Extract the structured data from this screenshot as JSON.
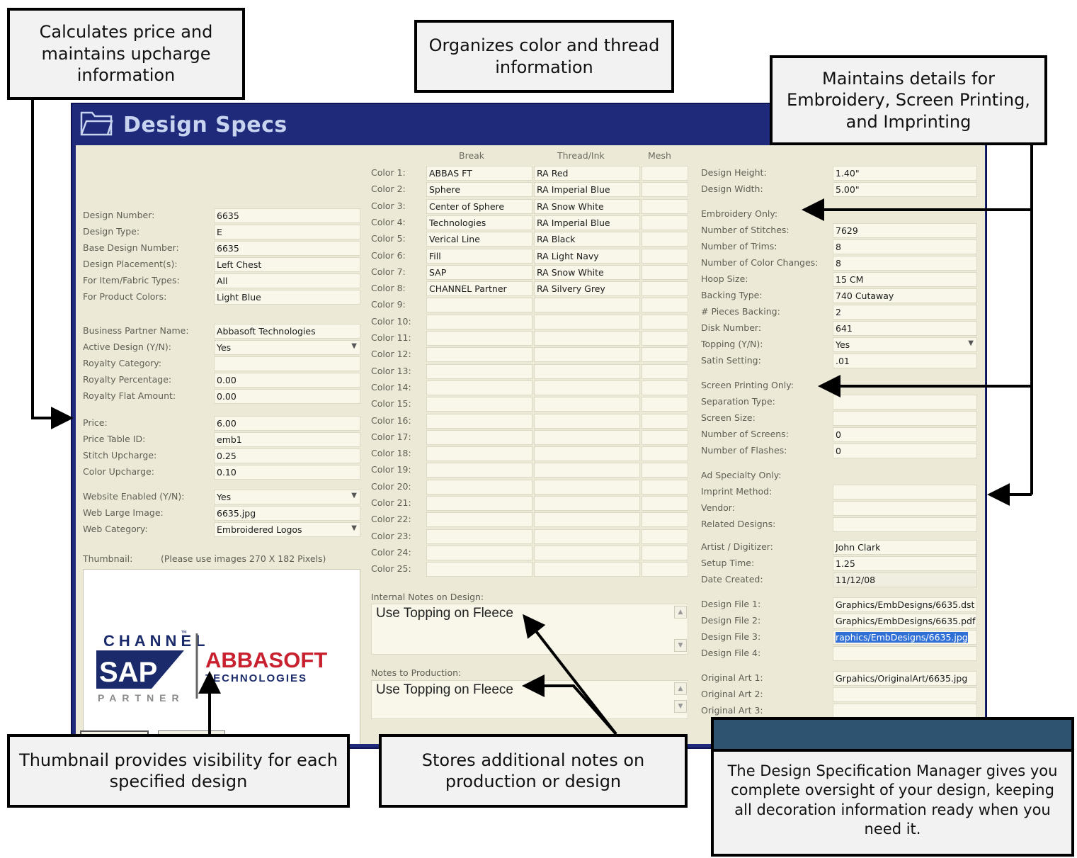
{
  "window": {
    "title": "Design Specs"
  },
  "left": {
    "fields": [
      {
        "label": "Design Number:",
        "value": "6635"
      },
      {
        "label": "Design Type:",
        "value": "E"
      },
      {
        "label": "Base Design Number:",
        "value": "6635"
      },
      {
        "label": "Design Placement(s):",
        "value": "Left Chest"
      },
      {
        "label": "For Item/Fabric Types:",
        "value": "All"
      },
      {
        "label": "For Product Colors:",
        "value": "Light Blue"
      },
      {
        "label": "Business Partner Name:",
        "value": "Abbasoft Technologies"
      },
      {
        "label": "Active Design (Y/N):",
        "value": "Yes"
      },
      {
        "label": "Royalty Category:",
        "value": ""
      },
      {
        "label": "Royalty Percentage:",
        "value": "0.00"
      },
      {
        "label": "Royalty Flat Amount:",
        "value": "0.00"
      },
      {
        "label": "Price:",
        "value": "6.00"
      },
      {
        "label": "Price Table ID:",
        "value": "emb1"
      },
      {
        "label": "Stitch Upcharge:",
        "value": "0.25"
      },
      {
        "label": "Color Upcharge:",
        "value": "0.10"
      },
      {
        "label": "Website Enabled (Y/N):",
        "value": "Yes"
      },
      {
        "label": "Web Large Image:",
        "value": "6635.jpg"
      },
      {
        "label": "Web Category:",
        "value": "Embroidered Logos"
      }
    ],
    "thumbnail_label": "Thumbnail:",
    "thumbnail_hint": "(Please use images  270 X 182  Pixels)",
    "logo": {
      "channel": "CHANNEL",
      "tm": "™",
      "sap": "SAP",
      "partner": "PARTNER",
      "abbasoft": "ABBASOFT",
      "technologies": "TECHNOLOGIES",
      "brand_blue": "#1b2a6b",
      "brand_red": "#c8202f"
    }
  },
  "colors": {
    "headers": {
      "break": "Break",
      "thread": "Thread/Ink",
      "mesh": "Mesh"
    },
    "rows": [
      {
        "label": "Color 1:",
        "break": "ABBAS FT",
        "thread": "RA Red"
      },
      {
        "label": "Color 2:",
        "break": "Sphere",
        "thread": "RA Imperial Blue"
      },
      {
        "label": "Color 3:",
        "break": "Center of Sphere",
        "thread": "RA Snow White"
      },
      {
        "label": "Color 4:",
        "break": "Technologies",
        "thread": "RA Imperial Blue"
      },
      {
        "label": "Color 5:",
        "break": "Verical Line",
        "thread": "RA Black"
      },
      {
        "label": "Color 6:",
        "break": "Fill",
        "thread": "RA Light Navy"
      },
      {
        "label": "Color 7:",
        "break": "SAP",
        "thread": "RA Snow White"
      },
      {
        "label": "Color 8:",
        "break": "CHANNEL Partner",
        "thread": "RA Silvery Grey"
      },
      {
        "label": "Color 9:",
        "break": "",
        "thread": ""
      },
      {
        "label": "Color 10:",
        "break": "",
        "thread": ""
      },
      {
        "label": "Color 11:",
        "break": "",
        "thread": ""
      },
      {
        "label": "Color 12:",
        "break": "",
        "thread": ""
      },
      {
        "label": "Color 13:",
        "break": "",
        "thread": ""
      },
      {
        "label": "Color 14:",
        "break": "",
        "thread": ""
      },
      {
        "label": "Color 15:",
        "break": "",
        "thread": ""
      },
      {
        "label": "Color 16:",
        "break": "",
        "thread": ""
      },
      {
        "label": "Color 17:",
        "break": "",
        "thread": ""
      },
      {
        "label": "Color 18:",
        "break": "",
        "thread": ""
      },
      {
        "label": "Color 19:",
        "break": "",
        "thread": ""
      },
      {
        "label": "Color 20:",
        "break": "",
        "thread": ""
      },
      {
        "label": "Color 21:",
        "break": "",
        "thread": ""
      },
      {
        "label": "Color 22:",
        "break": "",
        "thread": ""
      },
      {
        "label": "Color 23:",
        "break": "",
        "thread": ""
      },
      {
        "label": "Color 24:",
        "break": "",
        "thread": ""
      },
      {
        "label": "Color 25:",
        "break": "",
        "thread": ""
      }
    ],
    "internal_notes_label": "Internal Notes on Design:",
    "internal_notes": "Use Topping on Fleece",
    "production_notes_label": "Notes to Production:",
    "production_notes": "Use Topping on Fleece"
  },
  "right": {
    "fields": [
      {
        "label": "Design Height:",
        "value": "1.40\""
      },
      {
        "label": "Design Width:",
        "value": "5.00\""
      },
      {
        "label": "Embroidery Only:",
        "value": null
      },
      {
        "label": "Number of Stitches:",
        "value": "7629"
      },
      {
        "label": "Number of Trims:",
        "value": "8"
      },
      {
        "label": "Number of Color Changes:",
        "value": "8"
      },
      {
        "label": "Hoop Size:",
        "value": "15 CM"
      },
      {
        "label": "Backing Type:",
        "value": "740 Cutaway"
      },
      {
        "label": "# Pieces Backing:",
        "value": "2"
      },
      {
        "label": "Disk Number:",
        "value": "641"
      },
      {
        "label": "Topping (Y/N):",
        "value": "Yes"
      },
      {
        "label": "Satin Setting:",
        "value": ".01"
      },
      {
        "label": "Screen Printing Only:",
        "value": null
      },
      {
        "label": "Separation Type:",
        "value": ""
      },
      {
        "label": "Screen Size:",
        "value": ""
      },
      {
        "label": "Number of Screens:",
        "value": "0"
      },
      {
        "label": "Number of Flashes:",
        "value": "0"
      },
      {
        "label": "Ad Specialty Only:",
        "value": null
      },
      {
        "label": "Imprint Method:",
        "value": ""
      },
      {
        "label": "Vendor:",
        "value": ""
      },
      {
        "label": "Related Designs:",
        "value": ""
      },
      {
        "label": "Artist / Digitizer:",
        "value": "John Clark"
      },
      {
        "label": "Setup Time:",
        "value": "1.25"
      },
      {
        "label": "Date Created:",
        "value": "11/12/08"
      },
      {
        "label": "Design File 1:",
        "value": "Graphics/EmbDesigns/6635.dst"
      },
      {
        "label": "Design File 2:",
        "value": "Graphics/EmbDesigns/6635.pdf"
      },
      {
        "label": "Design File 3:",
        "value": "raphics/EmbDesigns/6635.jpg"
      },
      {
        "label": "Design File 4:",
        "value": ""
      },
      {
        "label": "Original Art 1:",
        "value": "Grpahics/OriginalArt/6635.jpg"
      },
      {
        "label": "Original Art 2:",
        "value": ""
      },
      {
        "label": "Original Art 3:",
        "value": ""
      }
    ]
  },
  "callouts": {
    "price": "Calculates price and maintains upcharge information",
    "color": "Organizes color and thread information",
    "details": "Maintains details for Embroidery, Screen Printing, and Imprinting",
    "thumbnail": "Thumbnail provides visibility for each specified design",
    "notes": "Stores additional notes on production or design",
    "manager": "The Design Specification Manager gives you complete oversight of your design, keeping all decoration information ready when you need it."
  },
  "colors_ui": {
    "window_blue": "#1f2a7a",
    "panel_bg": "#ecead6",
    "field_bg": "#f8f7ea",
    "manager_header": "#2e5370"
  }
}
